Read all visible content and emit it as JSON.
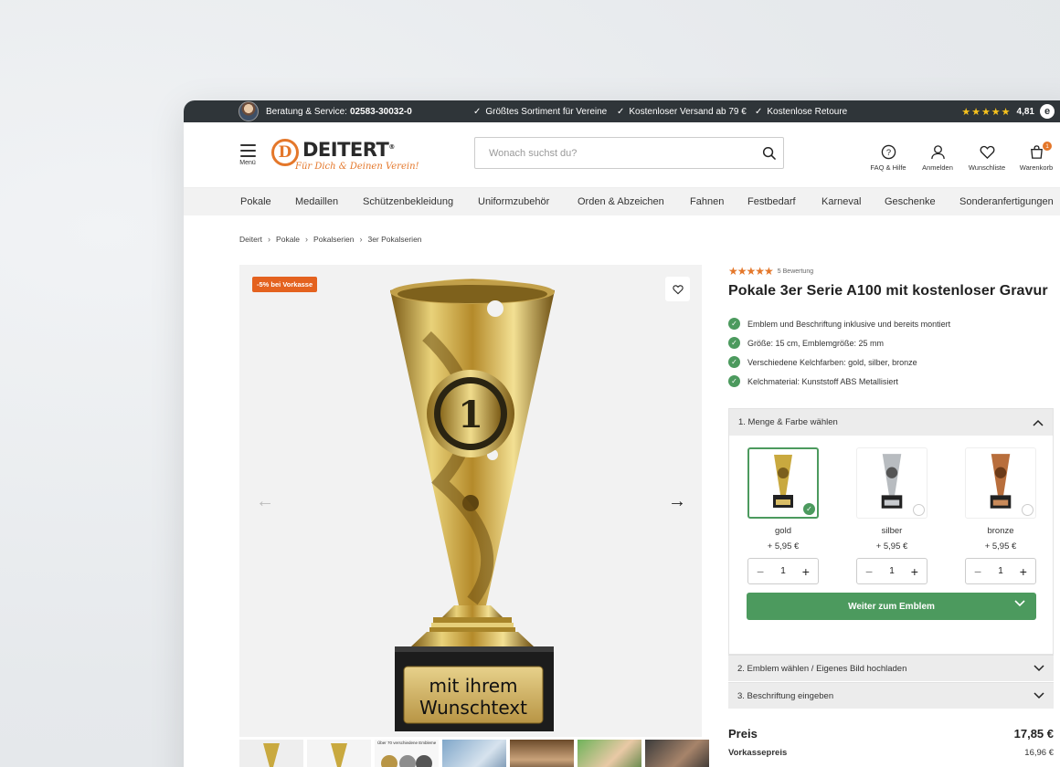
{
  "topbar": {
    "service_label": "Beratung & Service:",
    "service_phone": "02583-30032-0",
    "usps": [
      "Größtes Sortiment für Vereine",
      "Kostenloser Versand ab 79 €",
      "Kostenlose Retoure"
    ],
    "rating_stars": "★★★★★",
    "rating_score": "4,81",
    "trust_badge": "e"
  },
  "header": {
    "menu_label": "Menü",
    "logo_letter": "D",
    "logo_word": "DEITERT",
    "logo_reg": "®",
    "logo_slogan": "Für Dich & Deinen Verein!",
    "search_placeholder": "Wonach suchst du?",
    "icons": [
      {
        "name": "faq",
        "label": "FAQ & Hilfe"
      },
      {
        "name": "login",
        "label": "Anmelden"
      },
      {
        "name": "wishlist",
        "label": "Wunschliste"
      },
      {
        "name": "cart",
        "label": "Warenkorb",
        "badge": "1"
      }
    ]
  },
  "nav": [
    "Pokale",
    "Medaillen",
    "Schützenbekleidung",
    "Uniformzubehör",
    "Orden & Abzeichen",
    "Fahnen",
    "Festbedarf",
    "Karneval",
    "Geschenke",
    "Sonderanfertigungen"
  ],
  "breadcrumb": [
    "Deitert",
    "Pokale",
    "Pokalserien",
    "3er Pokalserien"
  ],
  "gallery": {
    "promo_badge": "-5% bei Vorkasse",
    "plate_line1": "mit ihrem",
    "plate_line2": "Wunschtext",
    "emblem_number": "1",
    "thumb_caption": "Über 70 verschiedene Embleme"
  },
  "product": {
    "stars": "★★★★★",
    "rating_count": "5 Bewertung",
    "title": "Pokale 3er Serie A100 mit kostenloser Gravur",
    "features": [
      "Emblem und Beschriftung inklusive und bereits montiert",
      "Größe: 15 cm, Emblemgröße: 25 mm",
      "Verschiedene Kelchfarben: gold, silber, bronze",
      "Kelchmaterial: Kunststoff ABS Metallisiert"
    ]
  },
  "configurator": {
    "step1_title": "1. Menge & Farbe wählen",
    "options": [
      {
        "name": "gold",
        "price": "+ 5,95 €",
        "qty": "1",
        "selected": true,
        "color": "#c9a93f"
      },
      {
        "name": "silber",
        "price": "+ 5,95 €",
        "qty": "1",
        "selected": false,
        "color": "#b8bcc0"
      },
      {
        "name": "bronze",
        "price": "+ 5,95 €",
        "qty": "1",
        "selected": false,
        "color": "#b86e3c"
      }
    ],
    "minus": "−",
    "plus": "+",
    "cta_label": "Weiter zum Emblem",
    "step2_title": "2. Emblem wählen / Eigenes Bild hochladen",
    "step3_title": "3. Beschriftung eingeben"
  },
  "price": {
    "label": "Preis",
    "value": "17,85 €",
    "prepay_label": "Vorkassepreis",
    "prepay_value": "16,96 €"
  },
  "colors": {
    "accent_orange": "#e4772a",
    "accent_green": "#4c9a5e",
    "topbar_bg": "#2f3539"
  }
}
